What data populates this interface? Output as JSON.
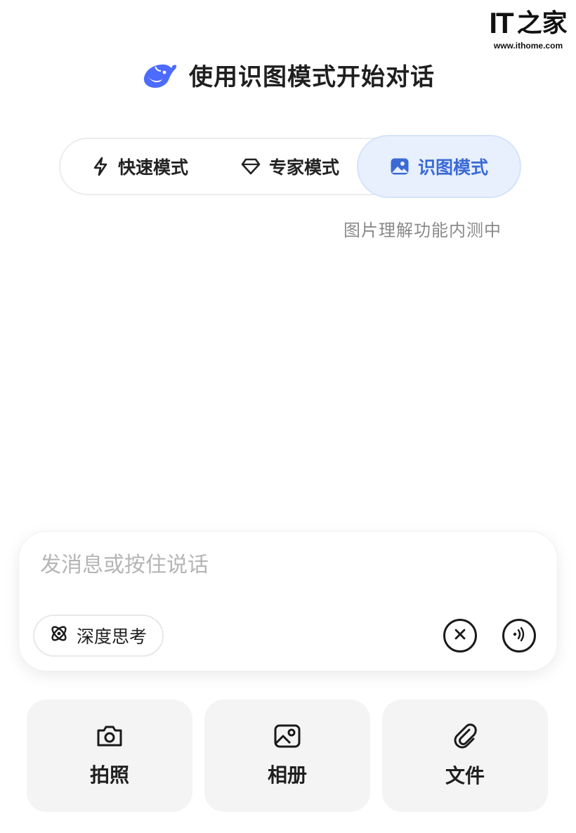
{
  "watermark": {
    "brand": "IT",
    "brand_cn": "之家",
    "url": "www.ithome.com"
  },
  "header": {
    "title": "使用识图模式开始对话"
  },
  "modes": {
    "items": [
      {
        "label": "快速模式",
        "icon": "lightning-icon",
        "selected": false
      },
      {
        "label": "专家模式",
        "icon": "gem-icon",
        "selected": false
      },
      {
        "label": "识图模式",
        "icon": "image-icon",
        "selected": true
      }
    ],
    "subtitle": "图片理解功能内测中"
  },
  "composer": {
    "placeholder": "发消息或按住说话",
    "deep_think_label": "深度思考",
    "deep_think_icon": "atom-icon",
    "close_icon": "close-icon",
    "voice_icon": "voice-icon"
  },
  "actions": [
    {
      "label": "拍照",
      "icon": "camera-icon"
    },
    {
      "label": "相册",
      "icon": "album-icon"
    },
    {
      "label": "文件",
      "icon": "paperclip-icon"
    }
  ],
  "colors": {
    "accent": "#3b6ad6",
    "accent_bg": "#e8f0fe",
    "logo": "#4d6bfe"
  }
}
